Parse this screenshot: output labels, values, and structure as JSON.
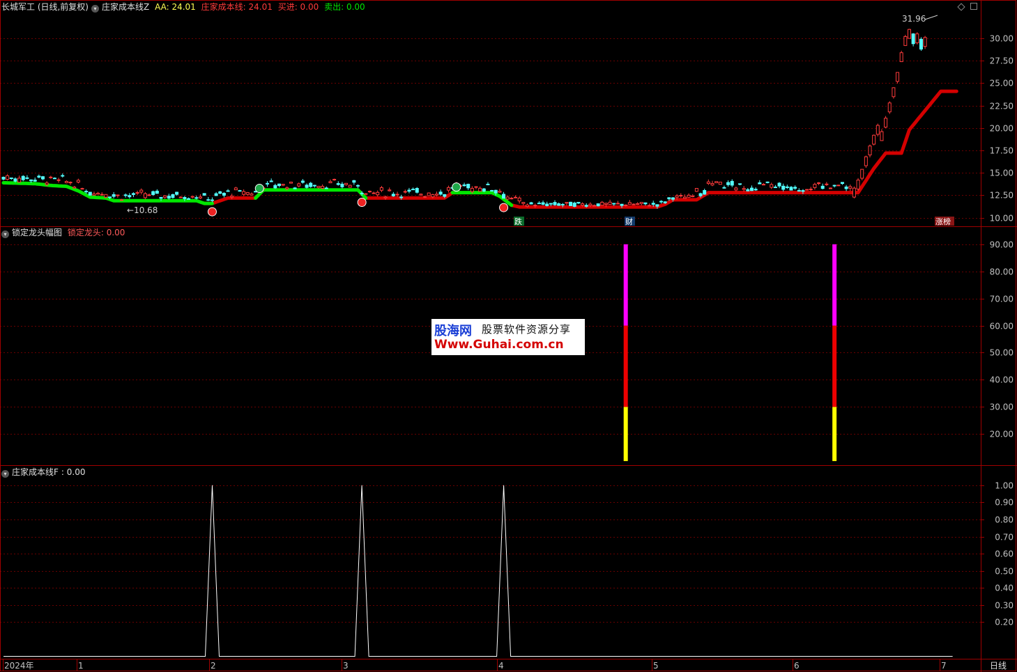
{
  "colors": {
    "background": "#000000",
    "frame": "#a00000",
    "grid": "#6a0000",
    "up": "#ff3b3b",
    "down": "#54ffff",
    "cost_red": "#d40000",
    "cost_green": "#00e600",
    "text": "#c0c0c0",
    "magenta": "#ff00ff",
    "yellow": "#ffff00"
  },
  "panel1": {
    "title": "长城军工 (日线,前复权)",
    "indicator": "庄家成本线Z",
    "aa_label": "AA: 24.01",
    "cost_label": "庄家成本线: 24.01",
    "buy_label": "买进: 0.00",
    "sell_label": "卖出: 0.00",
    "high_annotation": "31.96",
    "low_annotation": "10.68",
    "badge_die": "跌",
    "badge_cai": "财",
    "badge_zhangbang": "涨榜"
  },
  "panel2": {
    "title": "锁定龙头幅图",
    "label": "锁定龙头: 0.00"
  },
  "panel3": {
    "title": "庄家成本线F",
    "label": ": 0.00"
  },
  "x_axis": {
    "labels": [
      "2024年",
      "1",
      "2",
      "3",
      "4",
      "5",
      "6",
      "7"
    ],
    "period_label": "日线"
  },
  "watermark": {
    "logo": "股海网",
    "text": "股票软件资源分享",
    "url": "Www.Guhai.com.cn"
  },
  "chart_data": [
    {
      "type": "candlestick",
      "y_ticks": [
        "10.00",
        "12.50",
        "15.00",
        "17.50",
        "20.00",
        "22.50",
        "25.00",
        "27.50",
        "30.00"
      ],
      "ylim": [
        9.2,
        32.8
      ],
      "cost_line": {
        "points": [
          [
            0,
            13.9
          ],
          [
            8,
            13.8
          ],
          [
            12,
            13.6
          ],
          [
            16,
            13.5
          ],
          [
            19,
            13.0
          ],
          [
            22,
            12.3
          ],
          [
            26,
            12.2
          ],
          [
            28,
            11.9
          ],
          [
            49,
            11.9
          ],
          [
            51,
            11.6
          ],
          [
            53,
            11.6
          ],
          [
            57,
            12.2
          ],
          [
            64,
            12.2
          ],
          [
            66,
            13.1
          ],
          [
            90,
            13.1
          ],
          [
            92,
            12.2
          ],
          [
            112,
            12.2
          ],
          [
            114,
            12.8
          ],
          [
            124,
            12.8
          ],
          [
            126,
            12.4
          ],
          [
            129,
            11.4
          ],
          [
            131,
            11.2
          ],
          [
            166,
            11.2
          ],
          [
            168,
            11.5
          ],
          [
            170,
            12.0
          ],
          [
            176,
            12.0
          ],
          [
            179,
            12.8
          ],
          [
            216,
            12.8
          ],
          [
            217,
            12.8
          ],
          [
            221,
            15.5
          ],
          [
            224,
            17.2
          ],
          [
            228,
            17.2
          ],
          [
            230,
            19.8
          ],
          [
            238,
            24.1
          ],
          [
            242,
            24.1
          ]
        ],
        "green_ranges": [
          [
            0,
            53
          ],
          [
            64,
            92
          ],
          [
            114,
            129
          ]
        ],
        "red_ranges": [
          [
            51,
            66
          ],
          [
            90,
            116
          ],
          [
            127,
            242
          ]
        ]
      },
      "signals": [
        {
          "idx": 53,
          "kind": "red"
        },
        {
          "idx": 65,
          "kind": "green"
        },
        {
          "idx": 91,
          "kind": "red"
        },
        {
          "idx": 115,
          "kind": "green"
        },
        {
          "idx": 127,
          "kind": "red"
        }
      ]
    },
    {
      "type": "bar",
      "y_ticks": [
        "20.00",
        "30.00",
        "40.00",
        "50.00",
        "60.00",
        "70.00",
        "80.00",
        "90.00"
      ],
      "ylim": [
        9,
        92
      ],
      "bars": [
        {
          "idx": 158,
          "segments": [
            {
              "from": 10,
              "to": 30,
              "color": "yellow"
            },
            {
              "from": 30,
              "to": 60,
              "color": "red"
            },
            {
              "from": 60,
              "to": 90,
              "color": "magenta"
            }
          ]
        },
        {
          "idx": 211,
          "segments": [
            {
              "from": 10,
              "to": 30,
              "color": "yellow"
            },
            {
              "from": 30,
              "to": 60,
              "color": "red"
            },
            {
              "from": 60,
              "to": 90,
              "color": "magenta"
            }
          ]
        }
      ]
    },
    {
      "type": "line",
      "y_ticks": [
        "0.20",
        "0.30",
        "0.40",
        "0.50",
        "0.60",
        "0.70",
        "0.80",
        "0.90",
        "1.00"
      ],
      "ylim": [
        -0.01,
        1.04
      ],
      "spikes": [
        53,
        91,
        127
      ],
      "spike_value": 1.0,
      "baseline": 0.0
    }
  ]
}
